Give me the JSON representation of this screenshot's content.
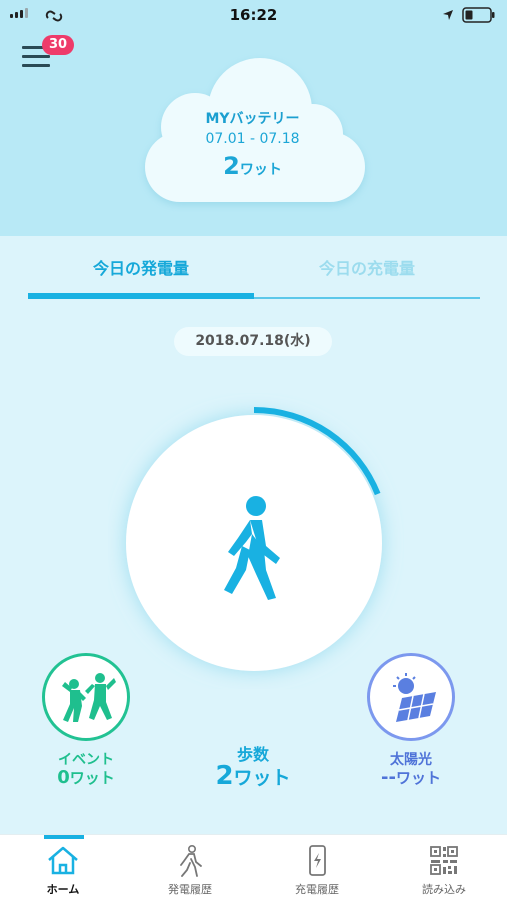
{
  "status_bar": {
    "time": "16:22"
  },
  "header": {
    "menu_badge_count": "30"
  },
  "battery_card": {
    "title": "MYバッテリー",
    "period": "07.01 - 07.18",
    "value_number": "2",
    "value_unit": "ワット"
  },
  "tabs": [
    {
      "label": "今日の発電量",
      "active": true
    },
    {
      "label": "今日の充電量",
      "active": false
    }
  ],
  "date": "2018.07.18(水)",
  "progress_fraction": 0.19,
  "main_icon": "walking-person-icon",
  "stats": {
    "event": {
      "label": "イベント",
      "value_number": "0",
      "value_unit": "ワット",
      "color": "#1fbf8e",
      "icon": "dancing-people-icon"
    },
    "steps": {
      "label": "歩数",
      "value_number": "2",
      "value_unit": "ワット",
      "color": "#16a8d9"
    },
    "solar": {
      "label": "太陽光",
      "value_number": "--",
      "value_unit": "ワット",
      "color": "#5a7fe0",
      "icon": "solar-panel-icon"
    }
  },
  "bottom_nav": [
    {
      "label": "ホーム",
      "icon": "home-icon",
      "active": true
    },
    {
      "label": "発電履歴",
      "icon": "walking-history-icon",
      "active": false
    },
    {
      "label": "充電履歴",
      "icon": "phone-charge-icon",
      "active": false
    },
    {
      "label": "読み込み",
      "icon": "qr-code-icon",
      "active": false
    }
  ],
  "colors": {
    "accent": "#19b1e2",
    "header_bg": "#b8e9f6",
    "body_bg": "#dcf4fb",
    "badge": "#ee3b6a"
  }
}
